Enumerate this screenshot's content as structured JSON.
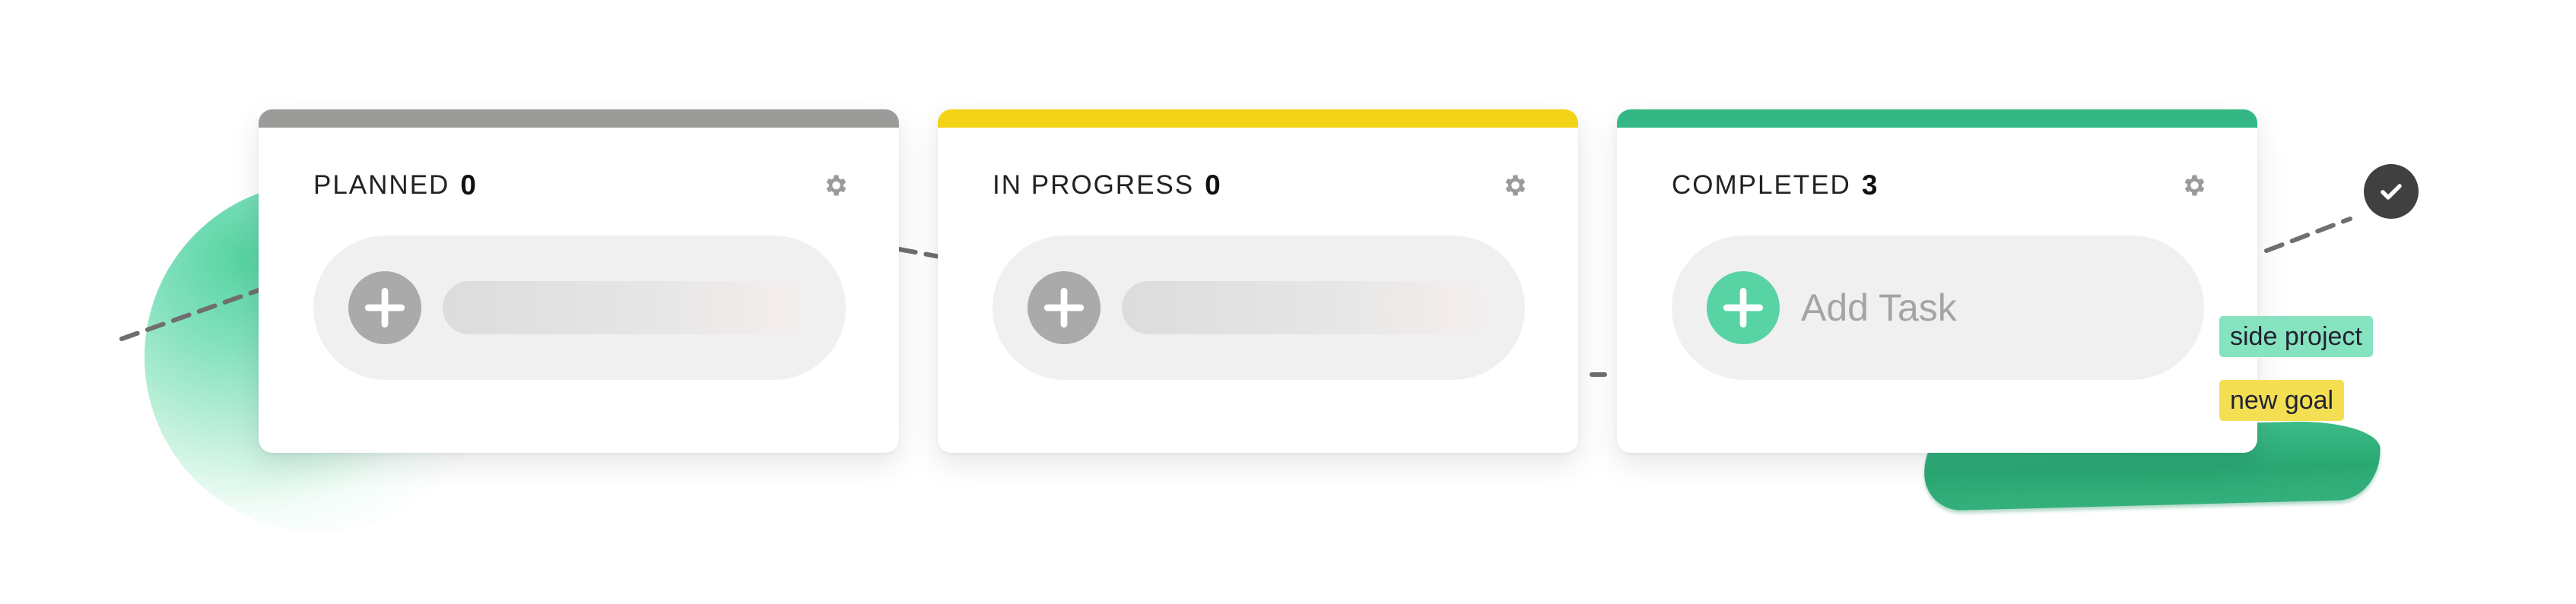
{
  "colors": {
    "planned_bar": "#9b9c9a",
    "in_progress_bar": "#f3d315",
    "completed_bar": "#33b885",
    "gray_button": "#aaaaaa",
    "green_button": "#58d3a4",
    "tag_green": "#86e3bf",
    "tag_yellow": "#f4df53"
  },
  "columns": [
    {
      "title": "PLANNED",
      "count": "0",
      "add_button_icon": "plus-icon",
      "settings_icon": "gear-icon"
    },
    {
      "title": "IN PROGRESS",
      "count": "0",
      "add_button_icon": "plus-icon",
      "settings_icon": "gear-icon"
    },
    {
      "title": "COMPLETED",
      "count": "3",
      "add_task_label": "Add Task",
      "add_button_icon": "plus-icon",
      "settings_icon": "gear-icon"
    }
  ],
  "tags": [
    {
      "label": "side project"
    },
    {
      "label": "new goal"
    }
  ],
  "status_icon": "checkmark-icon"
}
